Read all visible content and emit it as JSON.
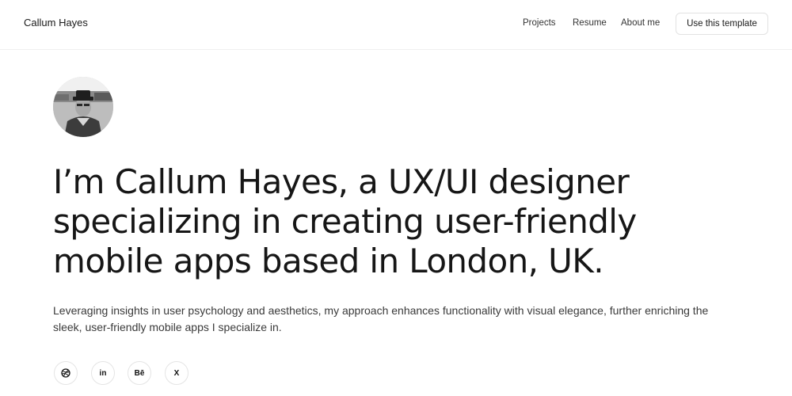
{
  "header": {
    "brand": "Callum Hayes",
    "nav": [
      "Projects",
      "Resume",
      "About me"
    ],
    "cta_label": "Use this template"
  },
  "hero": {
    "headline": "I’m Callum Hayes, a UX/UI designer specializing in creating user-friendly mobile apps based in London, UK.",
    "intro": "Leveraging insights in user psychology and aesthetics, my approach enhances functionality with visual elegance, further enriching the sleek, user-friendly mobile apps I specialize in."
  },
  "social": [
    {
      "icon": "dribbble-icon",
      "glyph": ""
    },
    {
      "icon": "linkedin-icon",
      "glyph": "in"
    },
    {
      "icon": "behance-icon",
      "glyph": "Bē"
    },
    {
      "icon": "x-icon",
      "glyph": "X"
    }
  ],
  "colors": {
    "text": "#161616",
    "muted": "#3a3a3a",
    "border": "#e4e4e4",
    "background": "#ffffff"
  }
}
